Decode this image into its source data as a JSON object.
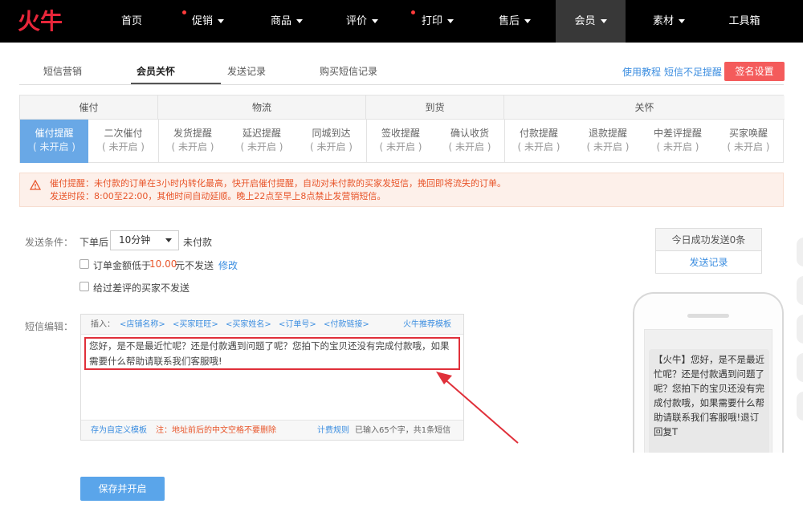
{
  "nav": {
    "logo_text": "火牛",
    "items": [
      {
        "label": "首页",
        "caret": false,
        "dot": false,
        "active": false
      },
      {
        "label": "促销",
        "caret": true,
        "dot": true,
        "active": false
      },
      {
        "label": "商品",
        "caret": true,
        "dot": false,
        "active": false
      },
      {
        "label": "评价",
        "caret": true,
        "dot": false,
        "active": false
      },
      {
        "label": "打印",
        "caret": true,
        "dot": true,
        "active": false
      },
      {
        "label": "售后",
        "caret": true,
        "dot": false,
        "active": false
      },
      {
        "label": "会员",
        "caret": true,
        "dot": false,
        "active": true
      },
      {
        "label": "素材",
        "caret": true,
        "dot": false,
        "active": false
      },
      {
        "label": "工具箱",
        "caret": false,
        "dot": false,
        "active": false
      }
    ]
  },
  "subtabs": [
    "短信营销",
    "会员关怀",
    "发送记录",
    "购买短信记录"
  ],
  "active_subtab": "会员关怀",
  "links": {
    "tutorial": "使用教程",
    "sms_shortage": "短信不足提醒"
  },
  "sign_button": "签名设置",
  "categories": {
    "groups": [
      "催付",
      "物流",
      "到货",
      "关怀"
    ],
    "status_text": "( 未开启 )",
    "items": [
      "催付提醒",
      "二次催付",
      "发货提醒",
      "延迟提醒",
      "同城到达",
      "签收提醒",
      "确认收货",
      "付款提醒",
      "退款提醒",
      "中差评提醒",
      "买家唤醒"
    ],
    "active_item": "催付提醒"
  },
  "warning": {
    "line1": "催付提醒：未付款的订单在3小时内转化最高，快开启催付提醒，自动对未付款的买家发短信，挽回即将流失的订单。",
    "line2": "发送时段：8:00至22:00，其他时间自动延顺。晚上22点至早上8点禁止发营销短信。"
  },
  "conditions": {
    "label": "发送条件：",
    "prefix": "下单后",
    "select_value": "10分钟",
    "suffix": "未付款",
    "amount_pre": "订单金额低于",
    "amount": "10.00",
    "amount_post": "元不发送",
    "modify": "修改",
    "bad_review": "给过差评的买家不发送"
  },
  "today": {
    "text": "今日成功发送0条",
    "record_link": "发送记录"
  },
  "editor": {
    "label": "短信编辑：",
    "insert": "插入：",
    "tags": [
      "<店铺名称>",
      "<买家旺旺>",
      "<买家姓名>",
      "<订单号>",
      "<付款链接>"
    ],
    "template_link": "火牛推荐模板",
    "content": "您好，是不是最近忙呢？还是付款遇到问题了呢？您拍下的宝贝还没有完成付款哦，如果需要什么帮助请联系我们客服哦!",
    "save_template": "存为自定义模板",
    "note": "注：地址前后的中文空格不要删除",
    "billing": "计费规则",
    "count": "已输入65个字，共1条短信"
  },
  "save_button": "保存并开启",
  "phone_preview": "【火牛】您好，是不是最近忙呢？还是付款遇到问题了呢？您拍下的宝贝还没有完成付款哦，如果需要什么帮助请联系我们客服哦!退订回复T",
  "colors": {
    "accent_red": "#f45b5b",
    "link_blue": "#3c8ee0",
    "active_blue": "#69a8e6",
    "warning": "#e8552a"
  }
}
